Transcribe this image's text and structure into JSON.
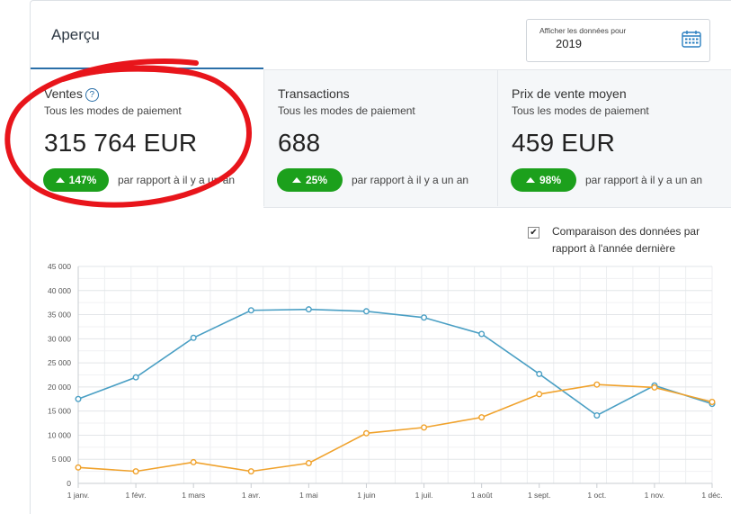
{
  "tab": {
    "label": "Aperçu"
  },
  "date_picker": {
    "label": "Afficher les données pour",
    "value": "2019",
    "icon": "calendar-icon"
  },
  "stats": [
    {
      "title": "Ventes",
      "help_icon": "question-circle-icon",
      "help_glyph": "?",
      "subtitle": "Tous les modes de paiement",
      "value": "315 764 EUR",
      "badge": "147%",
      "compare": "par rapport à il y a un an"
    },
    {
      "title": "Transactions",
      "subtitle": "Tous les modes de paiement",
      "value": "688",
      "badge": "25%",
      "compare": "par rapport à il y a un an"
    },
    {
      "title": "Prix de vente moyen",
      "subtitle": "Tous les modes de paiement",
      "value": "459 EUR",
      "badge": "98%",
      "compare": "par rapport à il y a un an"
    }
  ],
  "comparison": {
    "checked": true,
    "check_glyph": "✔",
    "label": "Comparaison des données par rapport à l'année dernière"
  },
  "colors": {
    "current": "#4a9fc4",
    "previous": "#f0a22c",
    "badge": "#1ca01c",
    "annotation": "#e8151b"
  },
  "chart_data": {
    "type": "line",
    "categories": [
      "1 janv.",
      "1 févr.",
      "1 mars",
      "1 avr.",
      "1 mai",
      "1 juin",
      "1 juil.",
      "1 août",
      "1 sept.",
      "1 oct.",
      "1 nov.",
      "1 déc."
    ],
    "y_ticks": [
      "0",
      "5 000",
      "10 000",
      "15 000",
      "20 000",
      "25 000",
      "30 000",
      "35 000",
      "40 000",
      "45 000"
    ],
    "ylim": [
      0,
      45000
    ],
    "grid": true,
    "series": [
      {
        "values": [
          17500,
          22000,
          30200,
          35900,
          36100,
          35700,
          34400,
          31000,
          22700,
          14100,
          20300,
          16500
        ]
      },
      {
        "values": [
          3300,
          2500,
          4400,
          2500,
          4200,
          10400,
          11600,
          13700,
          18500,
          20500,
          19900,
          16900
        ]
      }
    ]
  }
}
